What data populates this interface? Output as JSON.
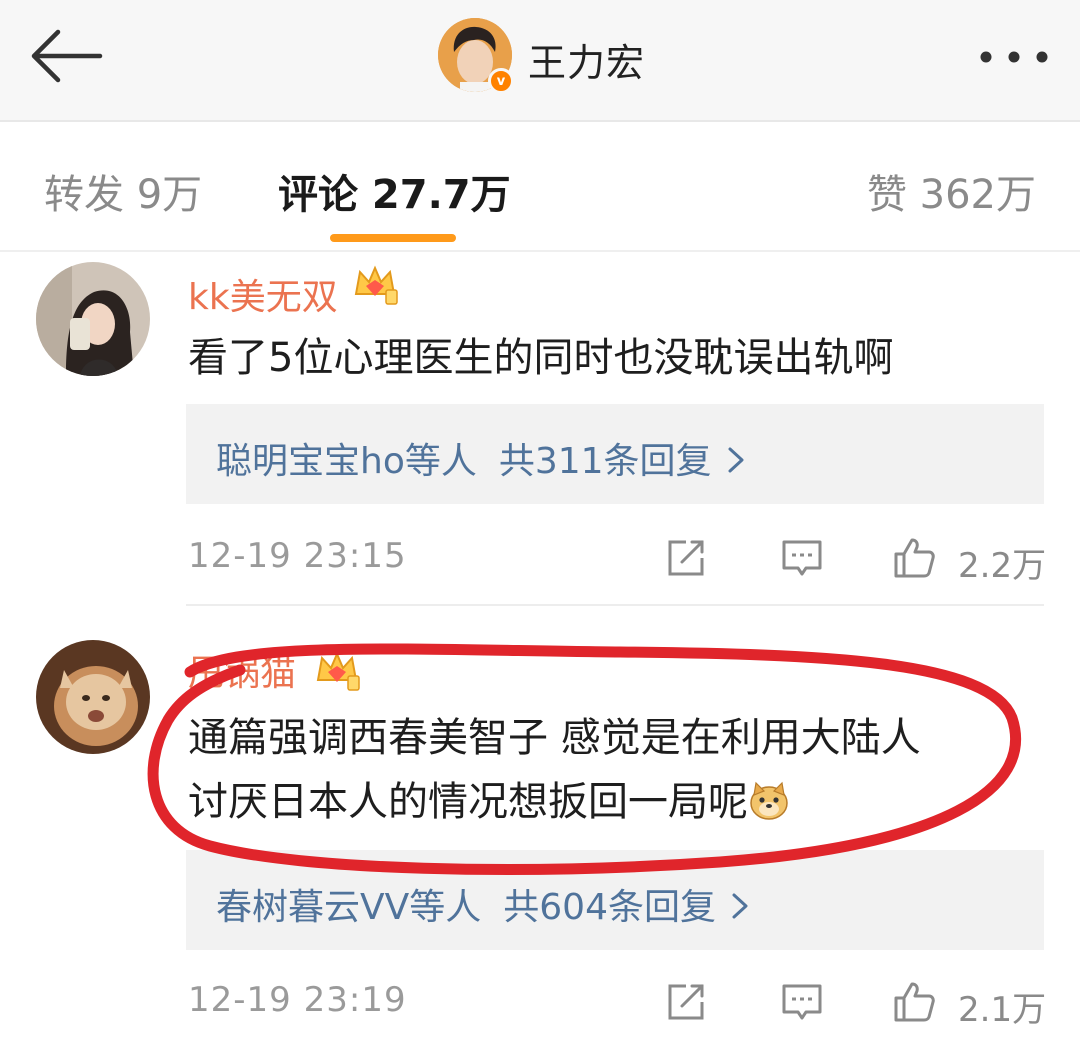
{
  "header": {
    "title": "王力宏",
    "verified_mark": "v",
    "back_icon": "arrow-left-icon",
    "more_icon": "more-dots-icon"
  },
  "tabs": [
    {
      "label": "转发 9万",
      "active": false
    },
    {
      "label": "评论 27.7万",
      "active": true
    },
    {
      "label": "赞 362万",
      "active": false
    }
  ],
  "comments": [
    {
      "username": "kk美无双",
      "badge_icon": "crown-level-icon",
      "text_lines": [
        "看了5位心理医生的同时也没耽误出轨啊"
      ],
      "replies": {
        "names": "聪明宝宝ho等人",
        "count": "共311条回复"
      },
      "time": "12-19 23:15",
      "likes": "2.2万"
    },
    {
      "username": "甩锅猫",
      "badge_icon": "crown-level-icon",
      "text_lines": [
        "通篇强调西春美智子 感觉是在利用大陆人",
        "讨厌日本人的情况想扳回一局呢"
      ],
      "emoji": "doge-emoji",
      "replies": {
        "names": "春树暮云VV等人",
        "count": "共604条回复"
      },
      "time": "12-19 23:19",
      "likes": "2.1万"
    }
  ],
  "colors": {
    "accent": "#ff9a1a",
    "username": "#eb7350",
    "link": "#50739b",
    "annotation": "#e0252b",
    "verified": "#ff8200"
  }
}
